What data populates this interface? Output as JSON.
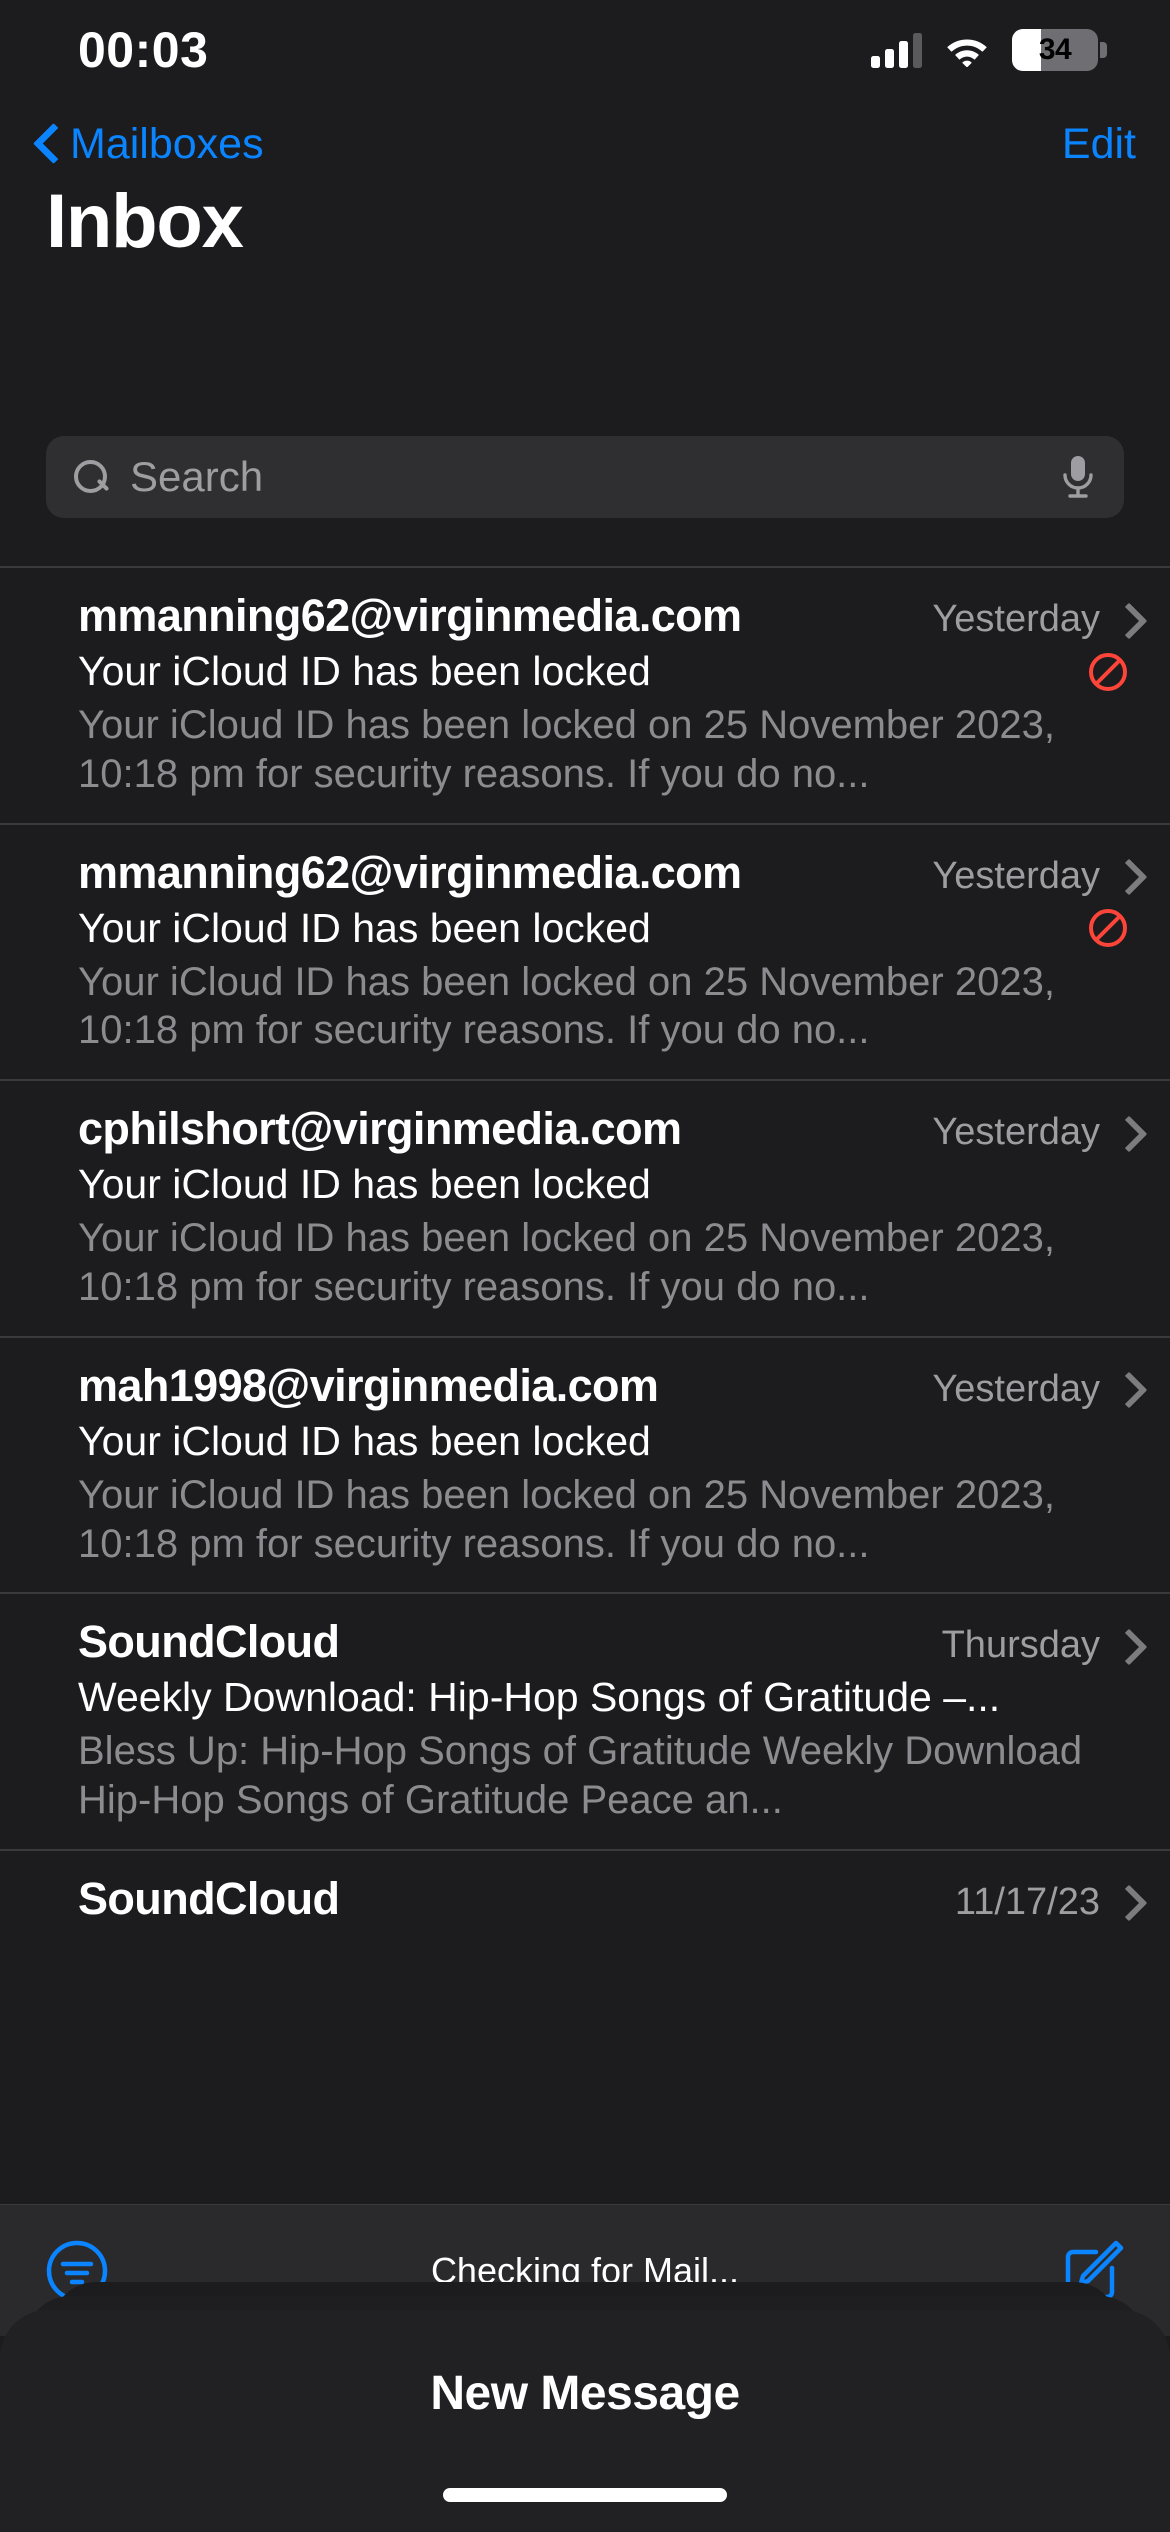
{
  "status_bar": {
    "time": "00:03",
    "cellular_icon": "cellular-bars-icon",
    "wifi_icon": "wifi-icon",
    "battery_percent": "34",
    "battery_level": 34
  },
  "nav_bar": {
    "back_label": "Mailboxes",
    "back_icon": "chevron-left-icon",
    "edit_label": "Edit"
  },
  "page_title": "Inbox",
  "search": {
    "placeholder": "Search",
    "value": "",
    "search_icon": "search-icon",
    "mic_icon": "microphone-icon"
  },
  "accent_color": "#0a84ff",
  "blocked_color": "#ff453a",
  "mail_list": [
    {
      "sender": "mmanning62@virginmedia.com",
      "date": "Yesterday",
      "subject": "Your iCloud ID has been locked",
      "preview": "Your iCloud ID has been locked on 25 November 2023, 10:18 pm for security reasons. If you do no...",
      "blocked": true
    },
    {
      "sender": "mmanning62@virginmedia.com",
      "date": "Yesterday",
      "subject": "Your iCloud ID has been locked",
      "preview": "Your iCloud ID has been locked on 25 November 2023, 10:18 pm for security reasons. If you do no...",
      "blocked": true
    },
    {
      "sender": "cphilshort@virginmedia.com",
      "date": "Yesterday",
      "subject": "Your iCloud ID has been locked",
      "preview": "Your iCloud ID has been locked on 25 November 2023, 10:18 pm for security reasons. If you do no...",
      "blocked": false
    },
    {
      "sender": "mah1998@virginmedia.com",
      "date": "Yesterday",
      "subject": "Your iCloud ID has been locked",
      "preview": "Your iCloud ID has been locked on 25 November 2023, 10:18 pm for security reasons. If you do no...",
      "blocked": false
    },
    {
      "sender": "SoundCloud",
      "date": "Thursday",
      "subject": "Weekly Download: Hip-Hop Songs of Gratitude –...",
      "preview": "Bless Up: Hip-Hop Songs of Gratitude Weekly Download Hip-Hop Songs of Gratitude Peace an...",
      "blocked": false
    },
    {
      "sender": "SoundCloud",
      "date": "11/17/23",
      "subject": "",
      "preview": "",
      "blocked": false
    }
  ],
  "toolbar": {
    "filter_icon": "filter-icon",
    "status_text": "Checking for Mail...",
    "compose_icon": "compose-icon"
  },
  "sheet": {
    "title": "New Message"
  }
}
